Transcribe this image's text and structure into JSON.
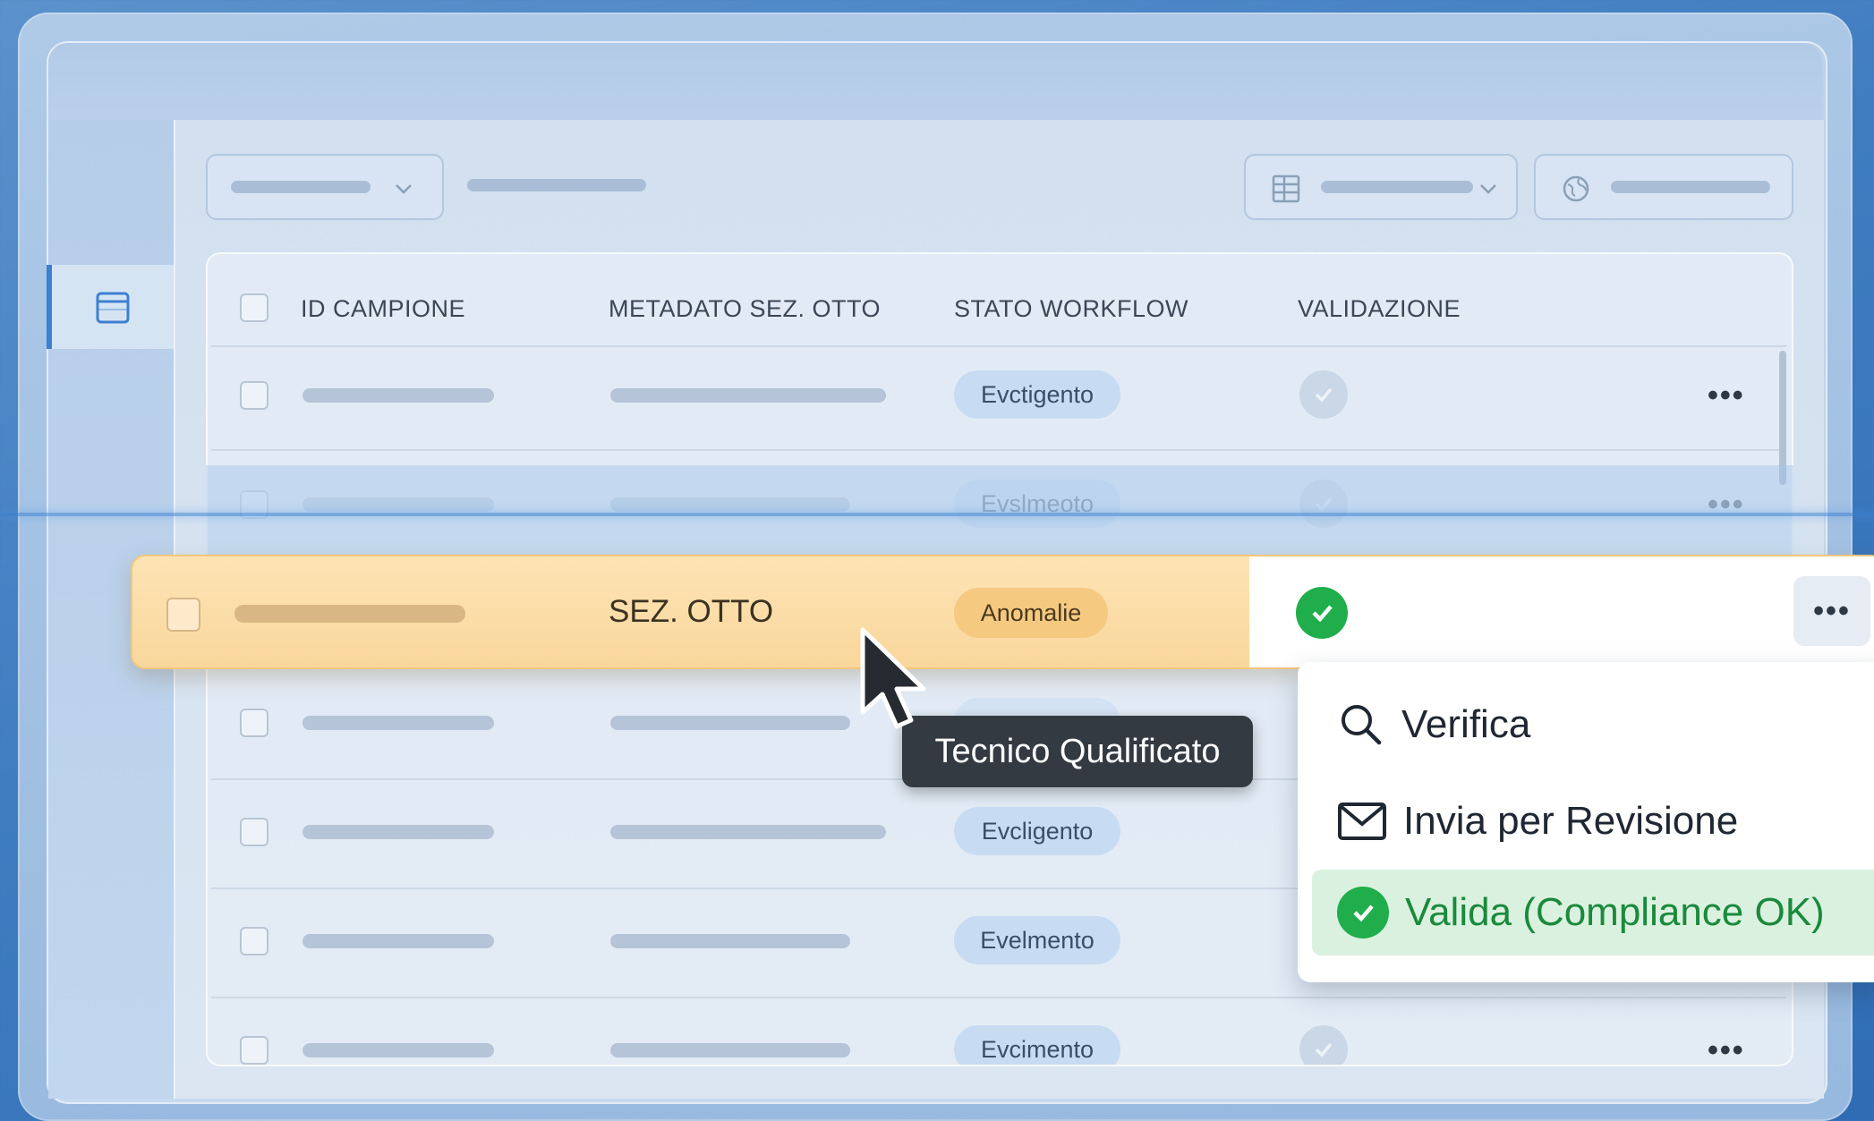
{
  "colors": {
    "accent": "#3d7fd1",
    "highlight_row": "#f9d79c",
    "anomaly_pill": "#f6c981",
    "success": "#1fae4b",
    "selected_menu_bg": "#dbf1df",
    "tooltip_bg": "#333a42"
  },
  "sidebar": {
    "active_icon": "window-icon"
  },
  "toolbar": {
    "filter_dropdown_icon": "chevron-down-icon",
    "view_dropdown_icon": "grid-icon",
    "globe_icon": "globe-icon"
  },
  "table": {
    "columns": [
      "ID CAMPIONE",
      "METADATO SEZ. OTTO",
      "STATO WORKFLOW",
      "VALIDAZIONE"
    ],
    "rows": [
      {
        "status": "Evctigento",
        "validated": true
      },
      {
        "status": "Evslmeoto",
        "validated": true
      },
      {
        "metadata": "SEZ. OTTO",
        "status": "Anomalie",
        "validated": true,
        "highlighted": true
      },
      {
        "status": "",
        "validated": false
      },
      {
        "status": "Evcligento",
        "validated": false
      },
      {
        "status": "Evelmento",
        "validated": false
      },
      {
        "status": "Evcimento",
        "validated": true
      }
    ]
  },
  "tooltip": {
    "text": "Tecnico Qualificato"
  },
  "context_menu": {
    "items": [
      {
        "label": "Verifica",
        "icon": "search-icon"
      },
      {
        "label": "Invia per Revisione",
        "icon": "mail-icon"
      },
      {
        "label": "Valida (Compliance OK)",
        "icon": "check-circle-icon",
        "selected": true
      }
    ]
  }
}
